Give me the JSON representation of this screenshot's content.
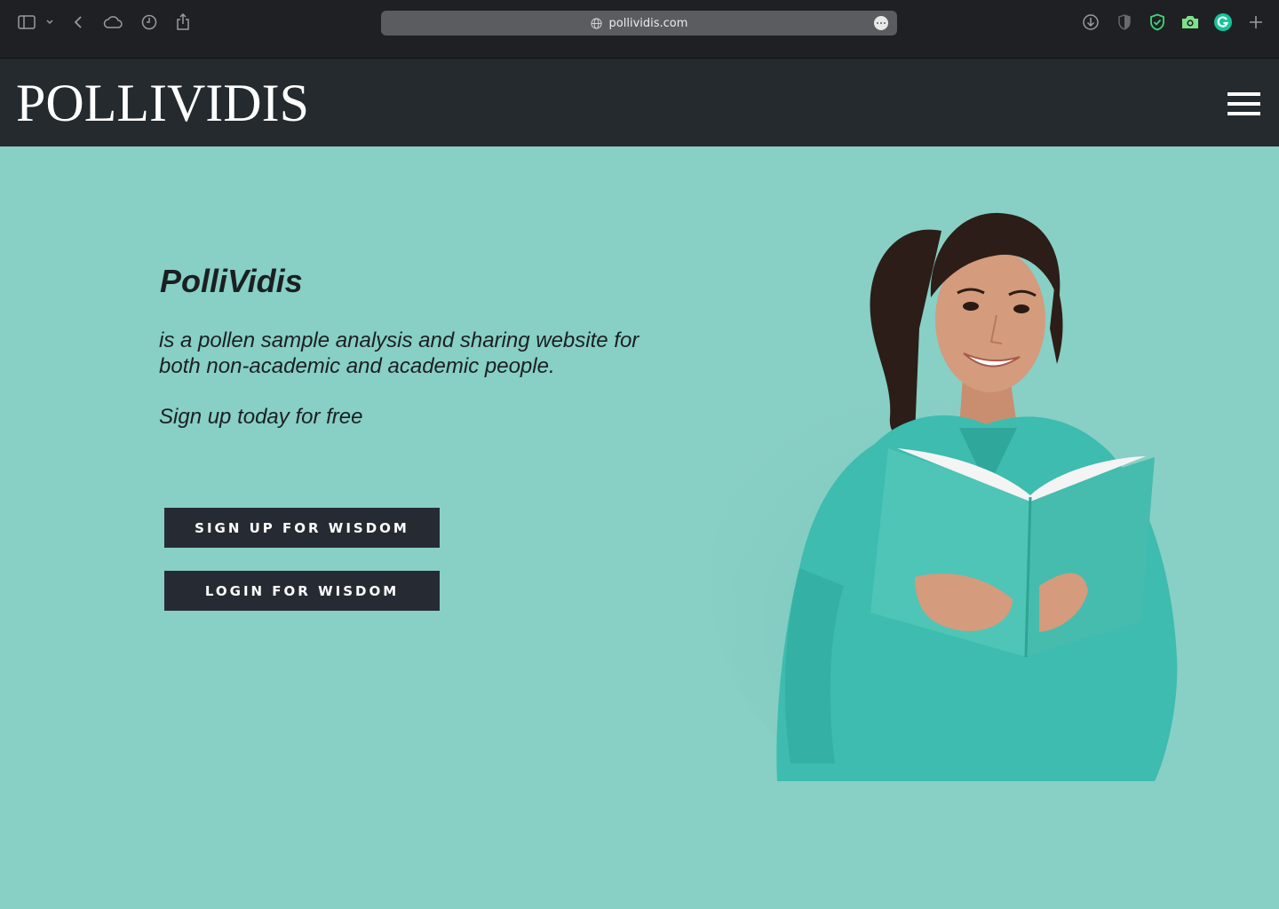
{
  "browser": {
    "url": "pollividis.com",
    "icons": [
      "sidebar-icon",
      "chevron-down-icon",
      "back-icon",
      "icloud-icon",
      "history-icon",
      "share-icon",
      "download-icon",
      "shield-half-icon",
      "shield-check-icon",
      "camera-icon",
      "grammarly-icon",
      "new-tab-icon"
    ]
  },
  "header": {
    "logo": "POLLIVIDIS",
    "menu_icon": "hamburger-menu-icon"
  },
  "hero": {
    "title": "PolliVidis",
    "description": "is a pollen sample analysis and sharing website for both non-academic and academic people.",
    "cta_text": "Sign up today for free",
    "signup_button": "SIGN UP FOR WISDOM",
    "login_button": "LOGIN FOR WISDOM"
  },
  "colors": {
    "background": "#88cfc5",
    "header": "#242a2e",
    "button": "#262b33",
    "chrome": "#1f2023"
  }
}
